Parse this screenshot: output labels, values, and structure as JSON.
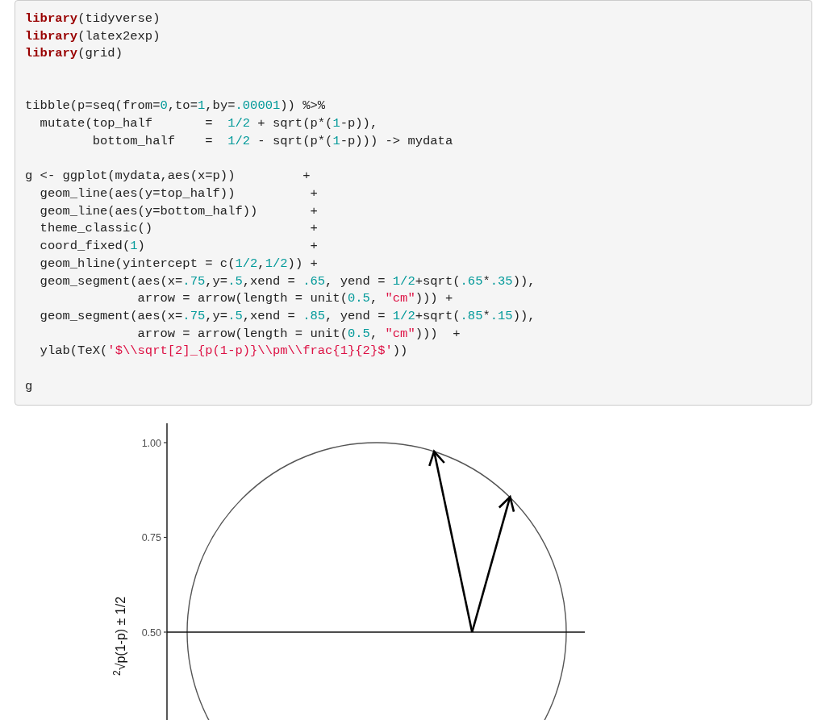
{
  "code_block": {
    "lines": [
      {
        "kind": "code",
        "tokens": [
          {
            "kind": "keyword",
            "text": "library"
          },
          {
            "kind": "plain",
            "text": "(tidyverse)"
          }
        ]
      },
      {
        "kind": "code",
        "tokens": [
          {
            "kind": "keyword",
            "text": "library"
          },
          {
            "kind": "plain",
            "text": "(latex2exp)"
          }
        ]
      },
      {
        "kind": "code",
        "tokens": [
          {
            "kind": "keyword",
            "text": "library"
          },
          {
            "kind": "plain",
            "text": "(grid)"
          }
        ]
      },
      {
        "kind": "blank"
      },
      {
        "kind": "blank"
      },
      {
        "kind": "code",
        "tokens": [
          {
            "kind": "plain",
            "text": "tibble(p=seq(from="
          },
          {
            "kind": "number",
            "text": "0"
          },
          {
            "kind": "plain",
            "text": ",to="
          },
          {
            "kind": "number",
            "text": "1"
          },
          {
            "kind": "plain",
            "text": ",by="
          },
          {
            "kind": "number",
            "text": ".00001"
          },
          {
            "kind": "plain",
            "text": ")) %>%"
          }
        ]
      },
      {
        "kind": "code",
        "tokens": [
          {
            "kind": "plain",
            "text": "  mutate(top_half       =  "
          },
          {
            "kind": "number",
            "text": "1/2"
          },
          {
            "kind": "plain",
            "text": " + sqrt(p*("
          },
          {
            "kind": "number",
            "text": "1"
          },
          {
            "kind": "plain",
            "text": "-p)),"
          }
        ]
      },
      {
        "kind": "code",
        "tokens": [
          {
            "kind": "plain",
            "text": "         bottom_half    =  "
          },
          {
            "kind": "number",
            "text": "1/2"
          },
          {
            "kind": "plain",
            "text": " - sqrt(p*("
          },
          {
            "kind": "number",
            "text": "1"
          },
          {
            "kind": "plain",
            "text": "-p))) -> mydata"
          }
        ]
      },
      {
        "kind": "blank"
      },
      {
        "kind": "code",
        "tokens": [
          {
            "kind": "plain",
            "text": "g <- ggplot(mydata,aes(x=p))         +"
          }
        ]
      },
      {
        "kind": "code",
        "tokens": [
          {
            "kind": "plain",
            "text": "  geom_line(aes(y=top_half))          +"
          }
        ]
      },
      {
        "kind": "code",
        "tokens": [
          {
            "kind": "plain",
            "text": "  geom_line(aes(y=bottom_half))       +"
          }
        ]
      },
      {
        "kind": "code",
        "tokens": [
          {
            "kind": "plain",
            "text": "  theme_classic()                     +"
          }
        ]
      },
      {
        "kind": "code",
        "tokens": [
          {
            "kind": "plain",
            "text": "  coord_fixed("
          },
          {
            "kind": "number",
            "text": "1"
          },
          {
            "kind": "plain",
            "text": ")                      +"
          }
        ]
      },
      {
        "kind": "code",
        "tokens": [
          {
            "kind": "plain",
            "text": "  geom_hline(yintercept = c("
          },
          {
            "kind": "number",
            "text": "1/2"
          },
          {
            "kind": "plain",
            "text": ","
          },
          {
            "kind": "number",
            "text": "1/2"
          },
          {
            "kind": "plain",
            "text": ")) +"
          }
        ]
      },
      {
        "kind": "code",
        "tokens": [
          {
            "kind": "plain",
            "text": "  geom_segment(aes(x="
          },
          {
            "kind": "number",
            "text": ".75"
          },
          {
            "kind": "plain",
            "text": ",y="
          },
          {
            "kind": "number",
            "text": ".5"
          },
          {
            "kind": "plain",
            "text": ",xend = "
          },
          {
            "kind": "number",
            "text": ".65"
          },
          {
            "kind": "plain",
            "text": ", yend = "
          },
          {
            "kind": "number",
            "text": "1/2"
          },
          {
            "kind": "plain",
            "text": "+sqrt("
          },
          {
            "kind": "number",
            "text": ".65"
          },
          {
            "kind": "plain",
            "text": "*"
          },
          {
            "kind": "number",
            "text": ".35"
          },
          {
            "kind": "plain",
            "text": ")),"
          }
        ]
      },
      {
        "kind": "code",
        "tokens": [
          {
            "kind": "plain",
            "text": "               arrow = arrow(length = unit("
          },
          {
            "kind": "number",
            "text": "0.5"
          },
          {
            "kind": "plain",
            "text": ", "
          },
          {
            "kind": "string",
            "text": "\"cm\""
          },
          {
            "kind": "plain",
            "text": "))) +"
          }
        ]
      },
      {
        "kind": "code",
        "tokens": [
          {
            "kind": "plain",
            "text": "  geom_segment(aes(x="
          },
          {
            "kind": "number",
            "text": ".75"
          },
          {
            "kind": "plain",
            "text": ",y="
          },
          {
            "kind": "number",
            "text": ".5"
          },
          {
            "kind": "plain",
            "text": ",xend = "
          },
          {
            "kind": "number",
            "text": ".85"
          },
          {
            "kind": "plain",
            "text": ", yend = "
          },
          {
            "kind": "number",
            "text": "1/2"
          },
          {
            "kind": "plain",
            "text": "+sqrt("
          },
          {
            "kind": "number",
            "text": ".85"
          },
          {
            "kind": "plain",
            "text": "*"
          },
          {
            "kind": "number",
            "text": ".15"
          },
          {
            "kind": "plain",
            "text": ")),"
          }
        ]
      },
      {
        "kind": "code",
        "tokens": [
          {
            "kind": "plain",
            "text": "               arrow = arrow(length = unit("
          },
          {
            "kind": "number",
            "text": "0.5"
          },
          {
            "kind": "plain",
            "text": ", "
          },
          {
            "kind": "string",
            "text": "\"cm\""
          },
          {
            "kind": "plain",
            "text": ")))  +"
          }
        ]
      },
      {
        "kind": "code",
        "tokens": [
          {
            "kind": "plain",
            "text": "  ylab(TeX("
          },
          {
            "kind": "string",
            "text": "'$\\\\sqrt[2]_{p(1-p)}\\\\pm\\\\frac{1}{2}$'"
          },
          {
            "kind": "plain",
            "text": "))"
          }
        ]
      },
      {
        "kind": "blank"
      },
      {
        "kind": "code",
        "tokens": [
          {
            "kind": "plain",
            "text": "g"
          }
        ]
      }
    ]
  },
  "plot": {
    "y_axis_title": "$^{2}$√p(1-p) ± 1/2",
    "y_tick_labels": [
      "1.00",
      "0.75",
      "0.50"
    ]
  }
}
